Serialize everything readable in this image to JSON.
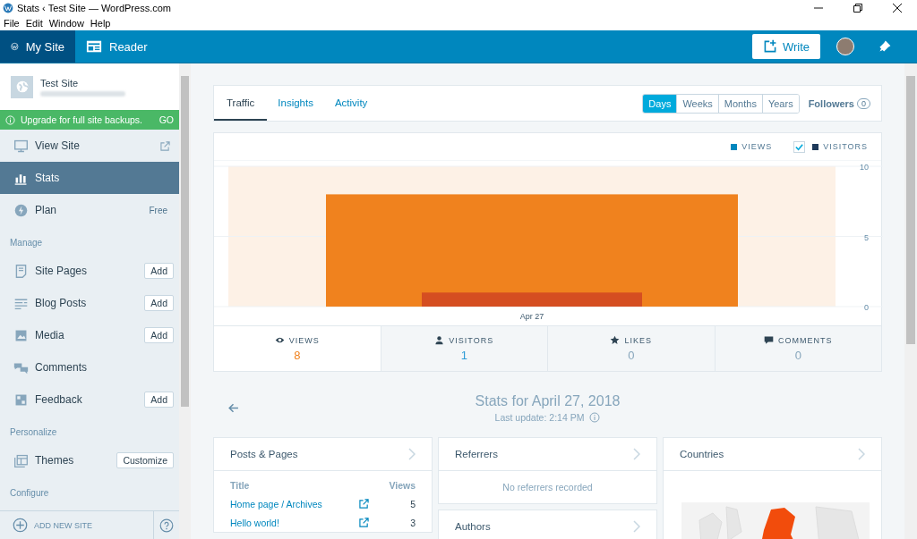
{
  "window": {
    "title": "Stats ‹ Test Site — WordPress.com"
  },
  "menu": [
    "File",
    "Edit",
    "Window",
    "Help"
  ],
  "masterbar": {
    "tabs": [
      {
        "label": "My Site",
        "selected": true
      },
      {
        "label": "Reader",
        "selected": false
      }
    ],
    "write_button": "Write"
  },
  "sidebar": {
    "site": {
      "name": "Test Site"
    },
    "notice": {
      "text": "Upgrade for full site backups.",
      "action": "GO"
    },
    "items": [
      {
        "kind": "link",
        "label": "View Site",
        "selected": false,
        "external": true
      },
      {
        "kind": "link",
        "label": "Stats",
        "selected": true
      },
      {
        "kind": "link",
        "label": "Plan",
        "selected": false,
        "badge": "Free"
      },
      {
        "kind": "heading",
        "label": "Manage"
      },
      {
        "kind": "link",
        "label": "Site Pages",
        "selected": false,
        "action": "Add"
      },
      {
        "kind": "link",
        "label": "Blog Posts",
        "selected": false,
        "action": "Add"
      },
      {
        "kind": "link",
        "label": "Media",
        "selected": false,
        "action": "Add"
      },
      {
        "kind": "link",
        "label": "Comments",
        "selected": false
      },
      {
        "kind": "link",
        "label": "Feedback",
        "selected": false,
        "action": "Add"
      },
      {
        "kind": "heading",
        "label": "Personalize"
      },
      {
        "kind": "link",
        "label": "Themes",
        "selected": false,
        "action": "Customize"
      },
      {
        "kind": "heading",
        "label": "Configure"
      }
    ],
    "footer": {
      "add_site": "ADD NEW SITE"
    }
  },
  "stats": {
    "tabs": [
      {
        "label": "Traffic",
        "selected": true
      },
      {
        "label": "Insights",
        "selected": false
      },
      {
        "label": "Activity",
        "selected": false
      }
    ],
    "periods": [
      {
        "label": "Days",
        "selected": true
      },
      {
        "label": "Weeks",
        "selected": false
      },
      {
        "label": "Months",
        "selected": false
      },
      {
        "label": "Years",
        "selected": false
      }
    ],
    "followers": {
      "label": "Followers",
      "count": "0"
    },
    "legend": [
      {
        "kind": "plain",
        "color": "#0087be"
      },
      {
        "kind": "checkbox",
        "color": "#1e3a5a",
        "checked": true
      }
    ],
    "chart_data": {
      "type": "bar",
      "categories": [
        "Apr 27"
      ],
      "series": [
        {
          "name": "VIEWS",
          "color": "#f0821e",
          "values": [
            8
          ]
        },
        {
          "name": "VISITORS",
          "color": "#d54e21",
          "values": [
            1
          ]
        }
      ],
      "ylim": [
        0,
        10
      ],
      "yticks": [
        0,
        5,
        10
      ]
    },
    "summary": [
      {
        "label": "VIEWS",
        "value": "8",
        "selected": true,
        "color": "#f0821e"
      },
      {
        "label": "VISITORS",
        "value": "1",
        "selected": false,
        "color": "#2e9bd6"
      },
      {
        "label": "LIKES",
        "value": "0",
        "selected": false,
        "color": "#87a6bc"
      },
      {
        "label": "COMMENTS",
        "value": "0",
        "selected": false,
        "color": "#87a6bc"
      }
    ],
    "day": {
      "title": "Stats for April 27, 2018",
      "updated": "Last update: 2:14 PM"
    },
    "posts": {
      "title": "Posts & Pages",
      "columns": [
        "Title",
        "Views"
      ],
      "rows": [
        {
          "title": "Home page / Archives",
          "views": "5"
        },
        {
          "title": "Hello world!",
          "views": "3"
        }
      ]
    },
    "referrers": {
      "title": "Referrers",
      "empty": "No referrers recorded"
    },
    "authors": {
      "title": "Authors"
    },
    "countries": {
      "title": "Countries"
    }
  }
}
